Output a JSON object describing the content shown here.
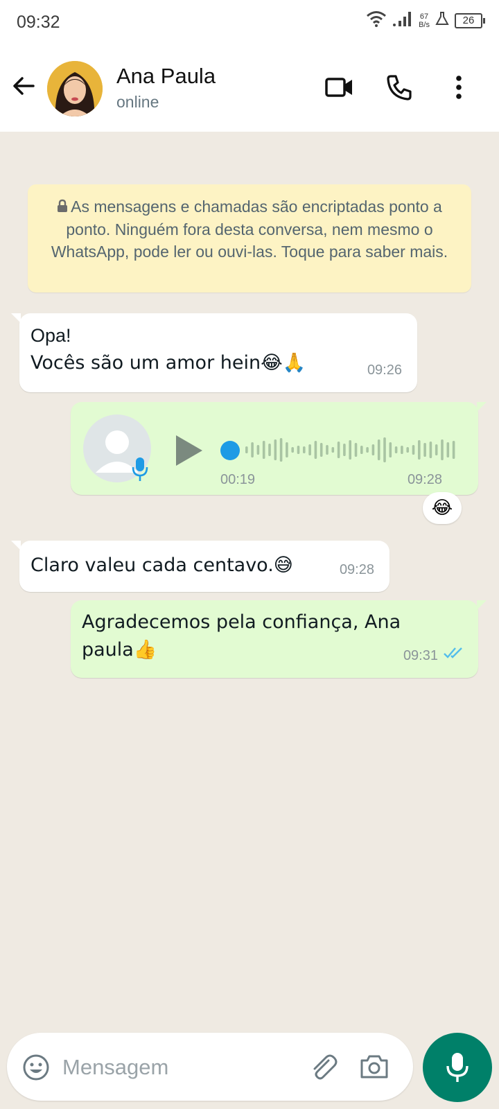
{
  "status_bar": {
    "time": "09:32",
    "net_speed_value": "67",
    "net_speed_unit": "B/s",
    "battery": "26"
  },
  "header": {
    "contact_name": "Ana Paula",
    "presence": "online"
  },
  "notice": {
    "text": "As mensagens e chamadas são encriptadas ponto a ponto. Ninguém fora desta conversa, nem mesmo o WhatsApp, pode ler ou ouvi-las. Toque para saber mais."
  },
  "messages": [
    {
      "direction": "incoming",
      "line1": "Opa!",
      "line2": "Vocês são um amor hein😂🙏",
      "time": "09:26"
    },
    {
      "direction": "outgoing",
      "type": "voice",
      "duration": "00:19",
      "time": "09:28",
      "reaction": "😂"
    },
    {
      "direction": "incoming",
      "text": "Claro valeu cada centavo.😅",
      "time": "09:28"
    },
    {
      "direction": "outgoing",
      "text": "Agradecemos pela confiança, Ana paula👍",
      "time": "09:31",
      "status": "read"
    }
  ],
  "composer": {
    "placeholder": "Mensagem"
  },
  "colors": {
    "accent": "#008069",
    "outgoing_bubble": "#e2fbd2",
    "notice_bg": "#fdf3c4",
    "read_ticks": "#53bdeb",
    "chat_bg": "#efeae2"
  }
}
